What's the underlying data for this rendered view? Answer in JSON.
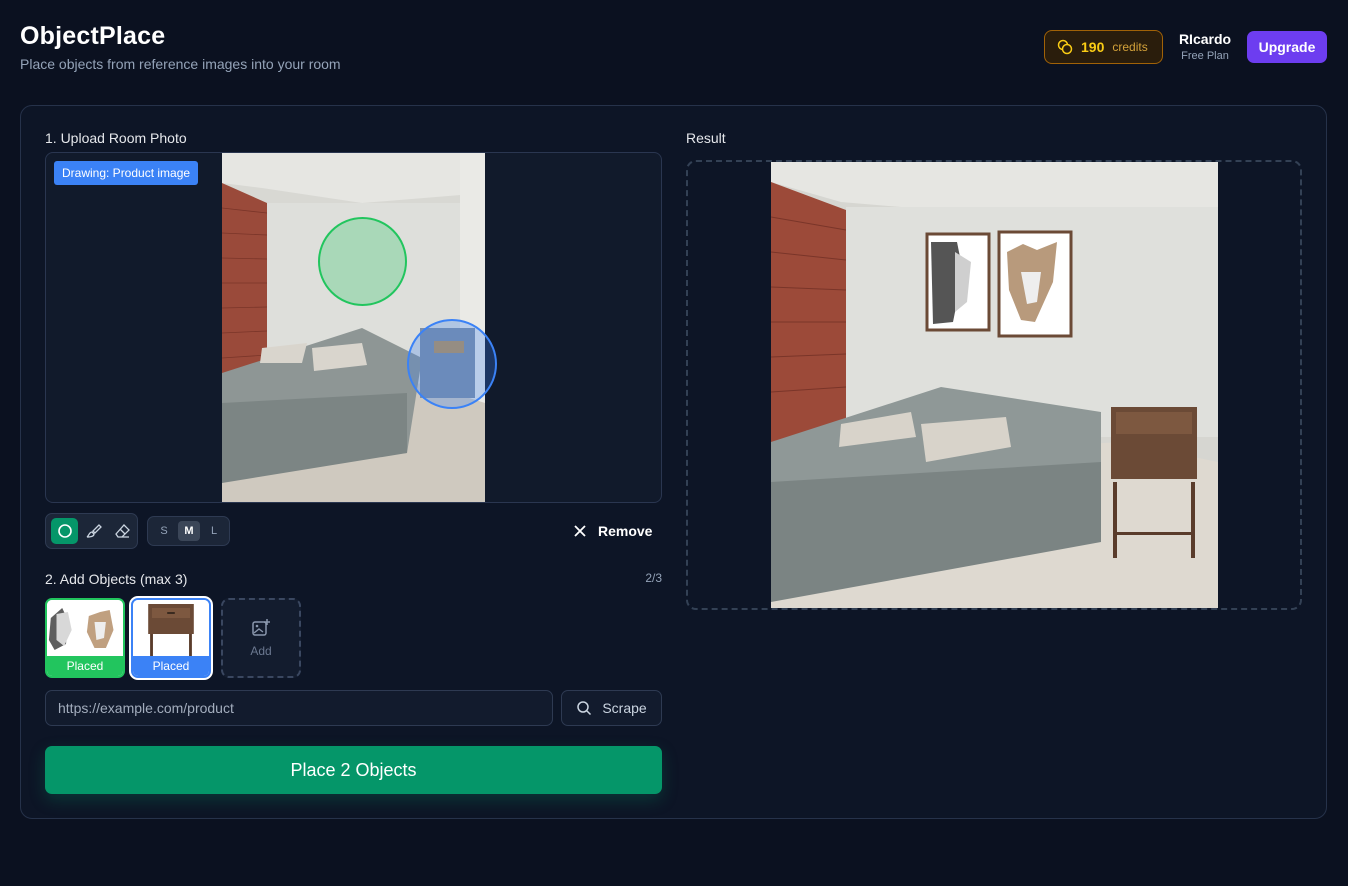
{
  "header": {
    "title": "ObjectPlace",
    "subtitle": "Place objects from reference images into your room",
    "credits_value": "190",
    "credits_label": "credits",
    "user_name": "RIcardo",
    "user_plan": "Free Plan",
    "upgrade_label": "Upgrade"
  },
  "room": {
    "section_label": "1. Upload Room Photo",
    "drawing_badge": "Drawing: Product image"
  },
  "toolbar": {
    "tools": [
      "circle-icon",
      "brush-icon",
      "eraser-icon"
    ],
    "active_tool": "circle",
    "sizes": [
      "S",
      "M",
      "L"
    ],
    "active_size": "M",
    "remove_label": "Remove"
  },
  "objects": {
    "section_label": "2. Add Objects (max 3)",
    "count": "2/3",
    "items": [
      {
        "status": "Placed",
        "color": "#22c55e"
      },
      {
        "status": "Placed",
        "color": "#3b82f6"
      }
    ],
    "add_label": "Add"
  },
  "scrape": {
    "placeholder": "https://example.com/product",
    "button_label": "Scrape"
  },
  "place_button_label": "Place 2 Objects",
  "result": {
    "section_label": "Result"
  },
  "colors": {
    "accent_green": "#059669",
    "accent_blue": "#3b82f6",
    "upgrade_purple": "#6d3df0",
    "credits_gold": "#facc15"
  }
}
